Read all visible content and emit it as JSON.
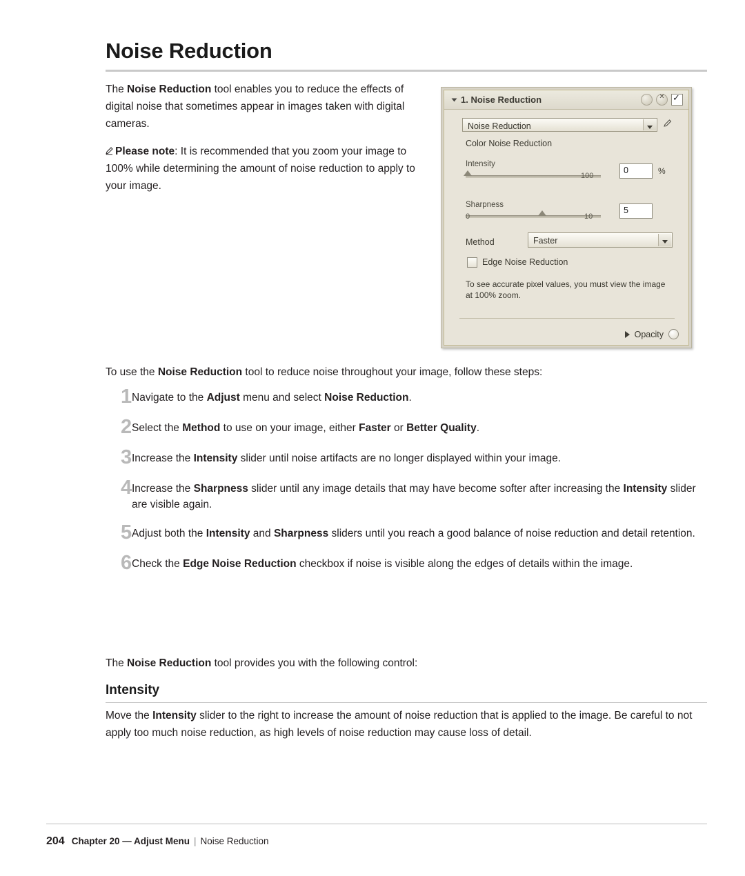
{
  "page": {
    "title": "Noise Reduction",
    "intro_parts": {
      "p1": "The ",
      "b1": "Noise Reduction",
      "p2": " tool enables you to reduce the effects of digital noise that sometimes appear in images taken with digital cameras."
    },
    "note": {
      "icon": "pencil-icon",
      "label": "Please note",
      "text": ": It is recommended that you zoom your image to 100% while determining the amount of noise reduction to apply to your image."
    },
    "use_intro": {
      "p1": "To use the ",
      "b1": "Noise Reduction",
      "p2": " tool to reduce noise throughout your image, follow these steps:"
    },
    "steps": [
      {
        "num": "1",
        "segments": [
          {
            "t": "Navigate to the ",
            "b": false
          },
          {
            "t": "Adjust",
            "b": true
          },
          {
            "t": " menu and select ",
            "b": false
          },
          {
            "t": "Noise Reduction",
            "b": true
          },
          {
            "t": ".",
            "b": false
          }
        ]
      },
      {
        "num": "2",
        "segments": [
          {
            "t": "Select the ",
            "b": false
          },
          {
            "t": "Method",
            "b": true
          },
          {
            "t": " to use on your image, either ",
            "b": false
          },
          {
            "t": "Faster",
            "b": true
          },
          {
            "t": " or ",
            "b": false
          },
          {
            "t": "Better Quality",
            "b": true
          },
          {
            "t": ".",
            "b": false
          }
        ]
      },
      {
        "num": "3",
        "segments": [
          {
            "t": "Increase the ",
            "b": false
          },
          {
            "t": "Intensity",
            "b": true
          },
          {
            "t": " slider until noise artifacts are no longer displayed within your image.",
            "b": false
          }
        ]
      },
      {
        "num": "4",
        "segments": [
          {
            "t": "Increase the ",
            "b": false
          },
          {
            "t": "Sharpness",
            "b": true
          },
          {
            "t": " slider until any image details that may have become softer after increasing the ",
            "b": false
          },
          {
            "t": "Intensity",
            "b": true
          },
          {
            "t": " slider are visible again.",
            "b": false
          }
        ]
      },
      {
        "num": "5",
        "segments": [
          {
            "t": "Adjust both the ",
            "b": false
          },
          {
            "t": "Intensity",
            "b": true
          },
          {
            "t": " and ",
            "b": false
          },
          {
            "t": "Sharpness",
            "b": true
          },
          {
            "t": " sliders until you reach a good balance of noise reduction and detail retention.",
            "b": false
          }
        ]
      },
      {
        "num": "6",
        "segments": [
          {
            "t": "Check the ",
            "b": false
          },
          {
            "t": "Edge Noise Reduction",
            "b": true
          },
          {
            "t": " checkbox if noise is visible along the edges of details within the image.",
            "b": false
          }
        ]
      }
    ],
    "control_intro": {
      "p1": "The ",
      "b1": "Noise Reduction",
      "p2": " tool provides you with the following control:"
    },
    "subheading": "Intensity",
    "last_para": {
      "p1": "Move the ",
      "b1": "Intensity",
      "p2": " slider to the right to increase the amount of noise reduction that is applied to the image. Be careful to not apply too much noise reduction, as high levels of noise reduction may cause loss of detail."
    },
    "footer": {
      "page_number": "204",
      "chapter": "Chapter 20 — Adjust Menu",
      "separator": "|",
      "section": "Noise Reduction"
    }
  },
  "screenshot": {
    "panel_title": "1. Noise Reduction",
    "header_icons": [
      "help-circle-icon",
      "close-circle-icon",
      "visibility-checkbox"
    ],
    "preset_dropdown": {
      "value": "Noise Reduction",
      "icon": "pencil-edit-icon"
    },
    "section_label": "Color Noise Reduction",
    "intensity": {
      "label": "Intensity",
      "min_tick": "",
      "max_tick": "100",
      "value": "0",
      "unit": "%"
    },
    "sharpness": {
      "label": "Sharpness",
      "min_tick": "0",
      "max_tick": "10",
      "value": "5"
    },
    "method": {
      "label": "Method",
      "value": "Faster"
    },
    "edge_noise_reduction": {
      "label": "Edge Noise Reduction",
      "checked": false
    },
    "hint": "To see accurate pixel values, you must view the image at 100% zoom.",
    "opacity": {
      "label": "Opacity"
    }
  }
}
